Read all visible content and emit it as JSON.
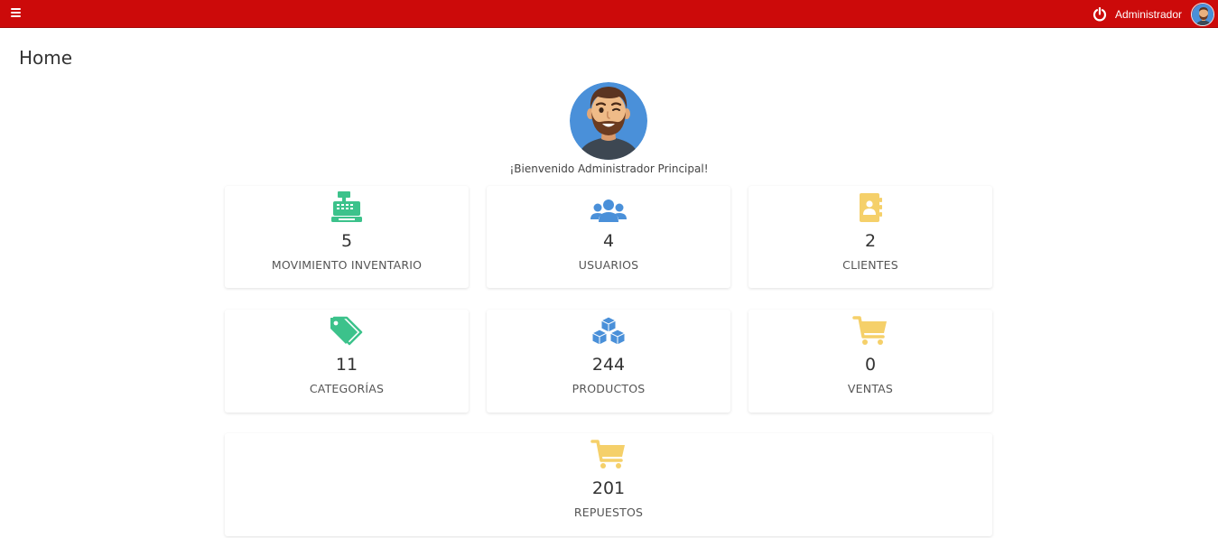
{
  "topbar": {
    "user_name": "Administrador",
    "bg_color": "#cc0a0a"
  },
  "page": {
    "title": "Home"
  },
  "welcome": {
    "text": "¡Bienvenido Administrador Principal!"
  },
  "cards": [
    {
      "value": "5",
      "label": "MOVIMIENTO INVENTARIO",
      "icon": "cash-register-icon",
      "color": "#3cc28b"
    },
    {
      "value": "4",
      "label": "USUARIOS",
      "icon": "users-icon",
      "color": "#4a90d9"
    },
    {
      "value": "2",
      "label": "CLIENTES",
      "icon": "address-book-icon",
      "color": "#f5d06a"
    },
    {
      "value": "11",
      "label": "CATEGORÍAS",
      "icon": "tags-icon",
      "color": "#3cc28b"
    },
    {
      "value": "244",
      "label": "PRODUCTOS",
      "icon": "cubes-icon",
      "color": "#4a90d9"
    },
    {
      "value": "0",
      "label": "VENTAS",
      "icon": "cart-icon",
      "color": "#f5d06a"
    },
    {
      "value": "201",
      "label": "REPUESTOS",
      "icon": "cart-icon",
      "color": "#f5d06a"
    }
  ]
}
